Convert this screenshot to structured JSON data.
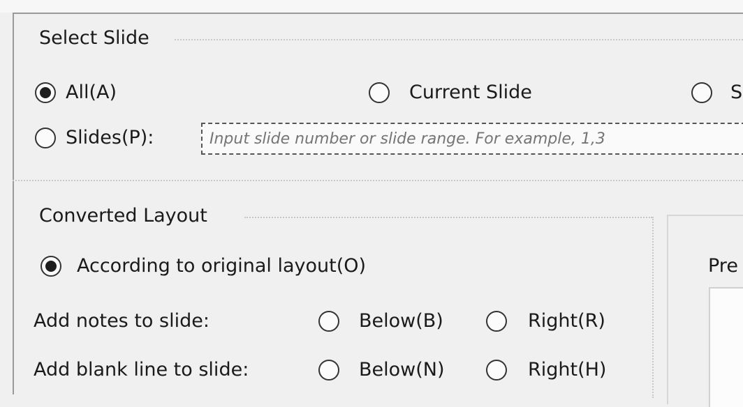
{
  "select_slide": {
    "title": "Select Slide",
    "options": {
      "all": {
        "label": "All(A)",
        "checked": true
      },
      "current": {
        "label": "Current Slide",
        "checked": false
      },
      "third": {
        "label": "S",
        "checked": false
      }
    },
    "slides": {
      "label": "Slides(P):",
      "checked": false,
      "placeholder": "Input slide number or slide range. For example, 1,3"
    }
  },
  "converted_layout": {
    "title": "Converted Layout",
    "original": {
      "label": "According to original layout(O)",
      "checked": true
    },
    "notes": {
      "label": "Add notes to slide:",
      "below": {
        "label": "Below(B)",
        "checked": false
      },
      "right": {
        "label": "Right(R)",
        "checked": false
      }
    },
    "blank": {
      "label": "Add blank line to slide:",
      "below": {
        "label": "Below(N)",
        "checked": false
      },
      "right": {
        "label": "Right(H)",
        "checked": false
      }
    }
  },
  "preview": {
    "title": "Pre"
  }
}
